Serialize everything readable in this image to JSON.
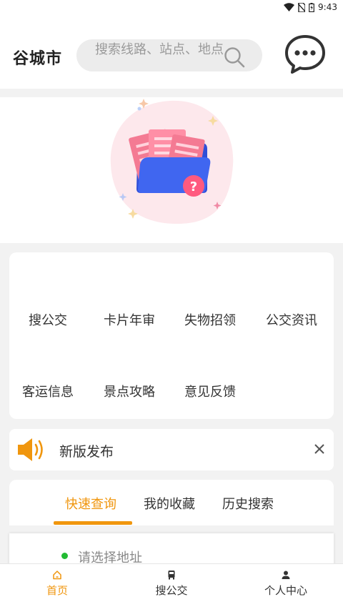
{
  "status_bar": {
    "time": "9:43"
  },
  "header": {
    "city": "谷城市",
    "search_placeholder": "搜索线路、站点、地点"
  },
  "menu": {
    "items": [
      "搜公交",
      "卡片年审",
      "失物招领",
      "公交资讯",
      "客运信息",
      "景点攻略",
      "意见反馈"
    ]
  },
  "notice": {
    "text": "新版发布"
  },
  "tabs": [
    "快速查询",
    "我的收藏",
    "历史搜索"
  ],
  "query": {
    "address_placeholder": "请选择地址"
  },
  "bottom_nav": [
    "首页",
    "搜公交",
    "个人中心"
  ],
  "colors": {
    "accent": "#f0960e",
    "indicator": "#22bb33"
  }
}
